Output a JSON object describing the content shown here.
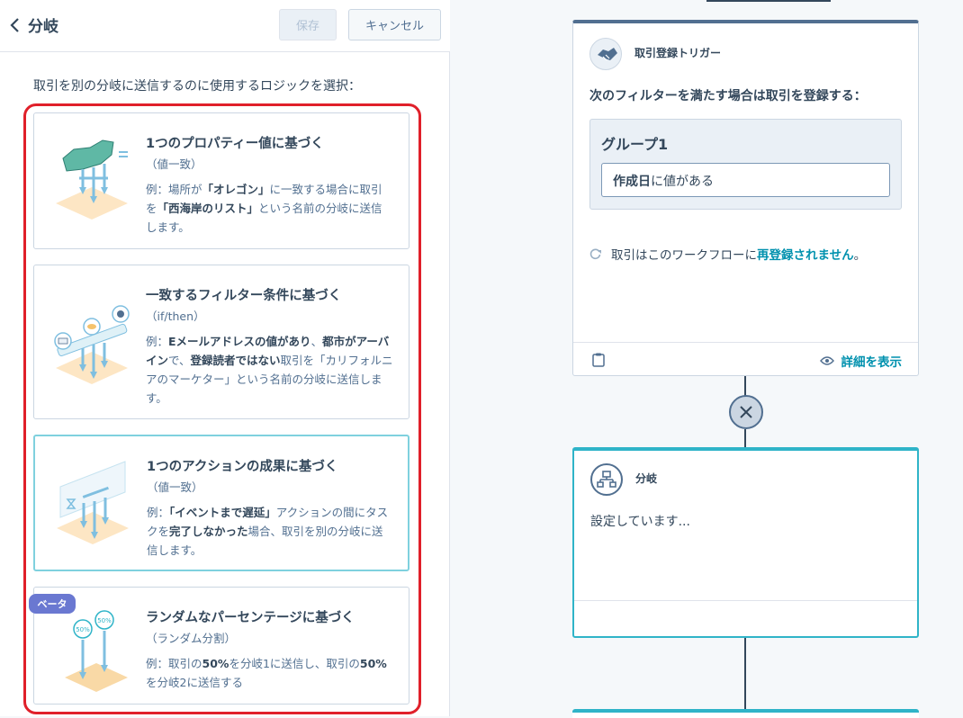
{
  "panel": {
    "title": "分岐",
    "save_label": "保存",
    "cancel_label": "キャンセル",
    "instruction": "取引を別の分岐に送信するのに使用するロジックを選択：",
    "options": [
      {
        "title": "1つのプロパティー値に基づく",
        "subtitle": "（値一致）",
        "desc_parts": [
          "例：場所が",
          "「オレゴン」",
          "に一致する場合に取引を",
          "「西海岸のリスト」",
          "という名前の分岐に送信します。"
        ]
      },
      {
        "title": "一致するフィルター条件に基づく",
        "subtitle": "（if/then）",
        "desc_parts": [
          "例：",
          "Eメールアドレスの値があり",
          "、",
          "都市がアーバイン",
          "で、",
          "登録読者ではない",
          "取引を「カリフォルニアのマーケター」という名前の分岐に送信します。"
        ]
      },
      {
        "title": "1つのアクションの成果に基づく",
        "subtitle": "（値一致）",
        "desc_parts": [
          "例：",
          "「イベントまで遅延」",
          "アクションの間にタスクを",
          "完了しなかった",
          "場合、取引を別の分岐に送信します。"
        ]
      },
      {
        "title": "ランダムなパーセンテージに基づく",
        "subtitle": "（ランダム分割）",
        "badge": "ベータ",
        "desc_parts": [
          "例：取引の",
          "50%",
          "を分岐1に送信し、取引の",
          "50%",
          "を分岐2に送信する"
        ]
      }
    ]
  },
  "trigger": {
    "title": "取引登録トリガー",
    "filter_heading": "次のフィルターを満たす場合は取引を登録する：",
    "group_title": "グループ1",
    "condition_bold": "作成日",
    "condition_rest": "に値がある",
    "reenroll_prefix": "取引はこのワークフローに",
    "reenroll_link": "再登録されません",
    "reenroll_suffix": "。",
    "details_label": "詳細を表示"
  },
  "branch": {
    "title": "分岐",
    "status": "設定しています..."
  },
  "colors": {
    "accent": "#0091ae",
    "highlight_border": "#e0202a",
    "branch_border": "#2fb4c8",
    "beta_badge": "#6a78d1"
  },
  "icons": [
    "chevron-left-icon",
    "handshake-icon",
    "refresh-icon",
    "clipboard-icon",
    "eye-icon",
    "close-icon",
    "branch-icon"
  ]
}
